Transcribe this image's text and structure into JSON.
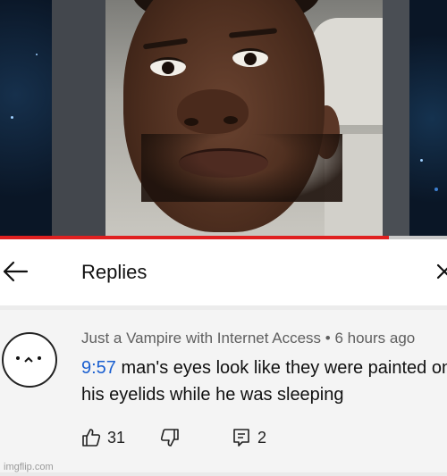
{
  "video": {
    "progress_fraction": 0.87,
    "progress_color": "#e02020"
  },
  "replies_panel": {
    "title": "Replies",
    "back_icon": "arrow-left-icon",
    "close_icon": "close-icon"
  },
  "comment": {
    "author": "Just a Vampire with Internet Access",
    "separator": "•",
    "time_ago": "6 hours ago",
    "timestamp_link": "9:57",
    "text": "man's eyes look like they were painted on his eyelids while he was sleeping",
    "likes": "31",
    "replies": "2",
    "link_color": "#1a5fd0"
  },
  "icons": {
    "like": "thumbs-up-icon",
    "dislike": "thumbs-down-icon",
    "reply": "reply-comment-icon"
  },
  "watermark": "imgflip.com"
}
